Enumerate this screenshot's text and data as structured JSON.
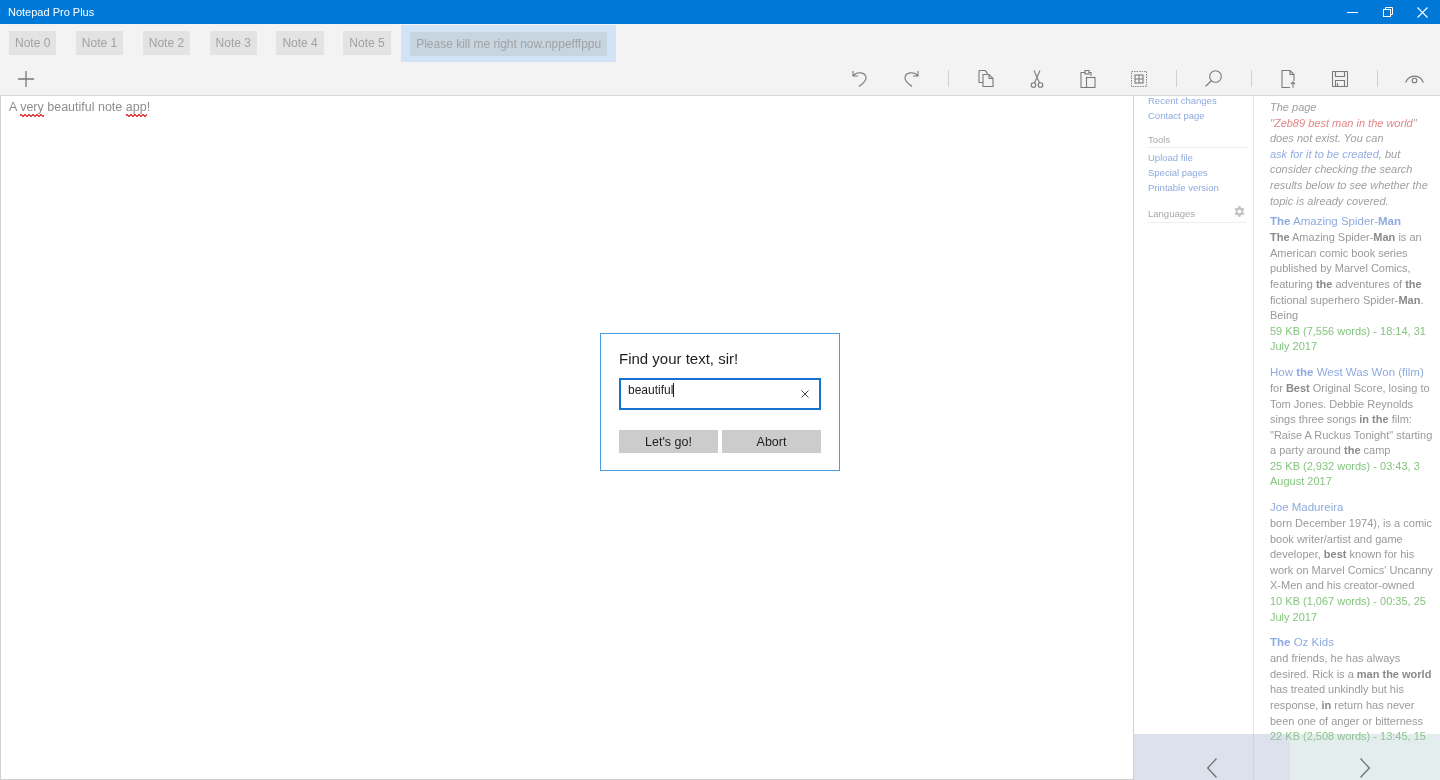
{
  "window": {
    "title": "Notepad Pro Plus"
  },
  "tabs": [
    {
      "label": "Note 0",
      "selected": false
    },
    {
      "label": "Note 1",
      "selected": false
    },
    {
      "label": "Note 2",
      "selected": false
    },
    {
      "label": "Note 3",
      "selected": false
    },
    {
      "label": "Note 4",
      "selected": false
    },
    {
      "label": "Note 5",
      "selected": false
    },
    {
      "label": "Please kill me right now.nppefffppu",
      "selected": true
    }
  ],
  "editor": {
    "segments": [
      {
        "text": "A ",
        "misspelled": false
      },
      {
        "text": "very",
        "misspelled": true
      },
      {
        "text": " beautiful note ",
        "misspelled": false
      },
      {
        "text": "app",
        "misspelled": true
      },
      {
        "text": "!",
        "misspelled": false
      }
    ]
  },
  "find_dialog": {
    "title": "Find your text, sir!",
    "value": "beautiful",
    "buttons": [
      "Let's go!",
      "Abort"
    ]
  },
  "sidebar": {
    "items": [
      {
        "kind": "link",
        "label": "Recent changes"
      },
      {
        "kind": "link",
        "label": "Contact page"
      },
      {
        "kind": "heading",
        "label": "Tools"
      },
      {
        "kind": "link",
        "label": "Upload file"
      },
      {
        "kind": "link",
        "label": "Special pages"
      },
      {
        "kind": "link",
        "label": "Printable version"
      },
      {
        "kind": "configurable",
        "label": "Languages"
      }
    ]
  },
  "search_results": {
    "notice": [
      {
        "kind": "text",
        "text": "The page \""
      },
      {
        "kind": "redlink",
        "text": "Zeb89 best man in the world"
      },
      {
        "kind": "text",
        "text": "\" does not exist. You can "
      },
      {
        "kind": "link",
        "text": "ask for it to be created"
      },
      {
        "kind": "text",
        "text": ", but consider checking the search results below to see whether the topic is already covered."
      }
    ],
    "results": [
      {
        "title": "**The** Amazing Spider-**Man**",
        "snippet": "**The** Amazing Spider-**Man** is an American comic book series published by Marvel Comics, featuring **the** adventures of **the** fictional superhero Spider-**Man**. Being",
        "meta": "59 KB (7,556 words) - 18:14, 31 July 2017"
      },
      {
        "title": "How **the** West Was Won (film)",
        "snippet": "for **Best** Original Score, losing to Tom Jones. Debbie Reynolds sings three songs **in the** film: \"Raise A Ruckus Tonight\" starting a party around **the** camp",
        "meta": "25 KB (2,932 words) - 03:43, 3 August 2017"
      },
      {
        "title": "Joe Madureira",
        "snippet": "born December 1974), is a comic book writer/artist and game developer, **best** known for his work on Marvel Comics' Uncanny X-Men and his creator-owned",
        "meta": "10 KB (1,067 words) - 00:35, 25 July 2017"
      },
      {
        "title": "**The** Oz Kids",
        "snippet": "and friends, he has always desired. Rick is a **man the world** has treated unkindly but his response, **in** return has never been one of anger or bitterness",
        "meta": "22 KB (2,508 words) - 13:45, 15"
      }
    ]
  }
}
